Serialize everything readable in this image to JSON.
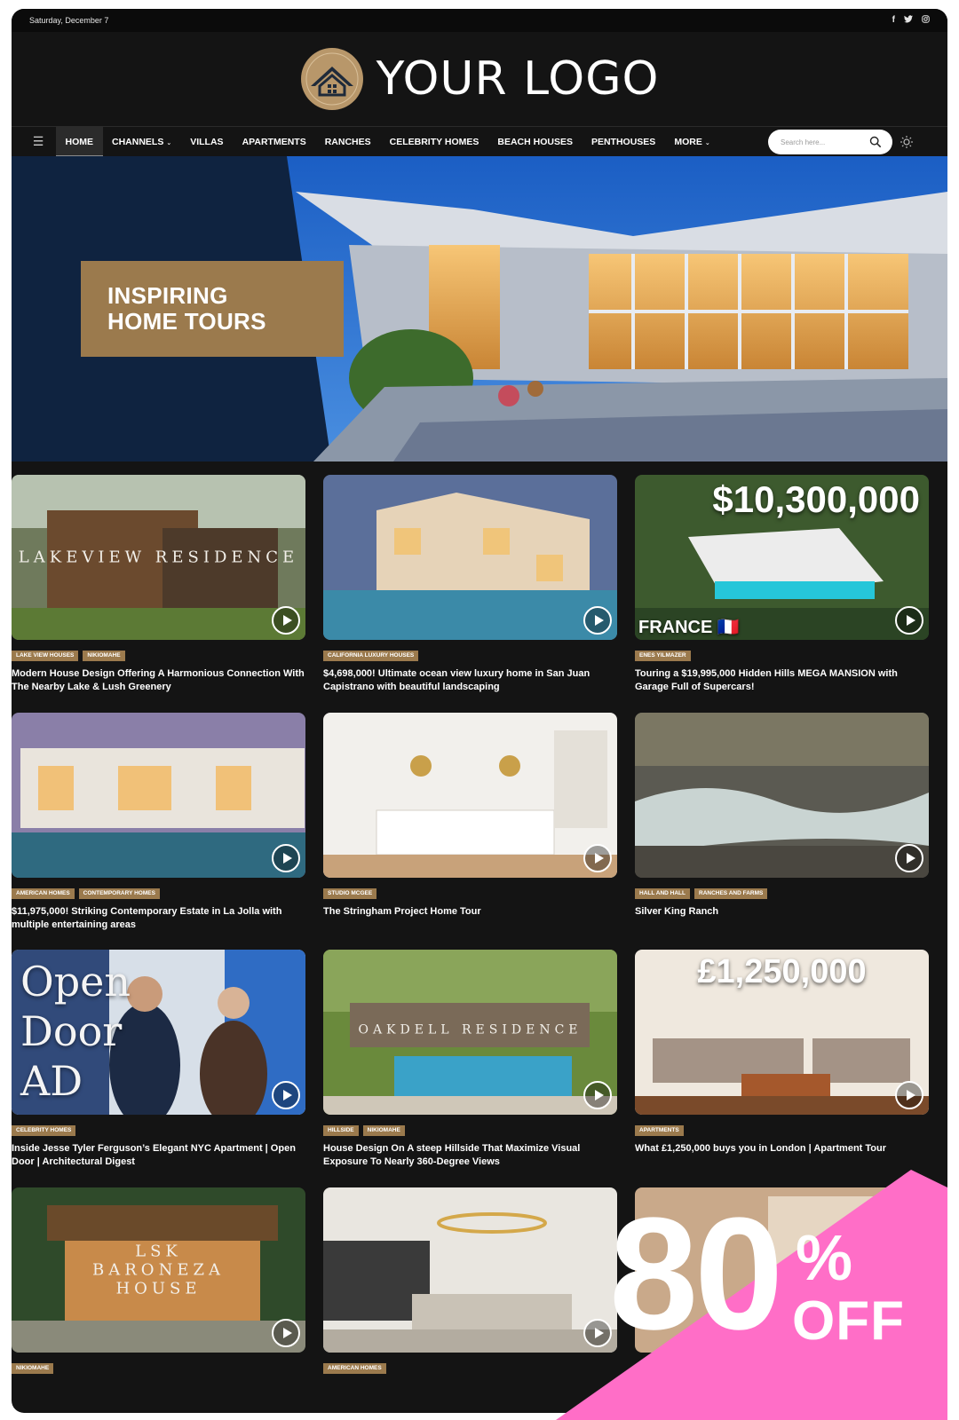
{
  "topbar": {
    "date": "Saturday, December 7",
    "socials": [
      {
        "icon": "facebook-icon",
        "glyph": "f"
      },
      {
        "icon": "twitter-icon",
        "glyph": "🐦"
      },
      {
        "icon": "instagram-icon",
        "glyph": "◎"
      }
    ]
  },
  "logo": {
    "text": "YOUR LOGO"
  },
  "nav": {
    "items": [
      {
        "label": "HOME",
        "active": true
      },
      {
        "label": "CHANNELS",
        "dropdown": true
      },
      {
        "label": "VILLAS"
      },
      {
        "label": "APARTMENTS"
      },
      {
        "label": "RANCHES"
      },
      {
        "label": "CELEBRITY HOMES"
      },
      {
        "label": "BEACH HOUSES"
      },
      {
        "label": "PENTHOUSES"
      },
      {
        "label": "MORE",
        "dropdown": true
      }
    ],
    "search_placeholder": "Search here..."
  },
  "hero": {
    "line1": "INSPIRING",
    "line2": "HOME TOURS"
  },
  "cards": [
    {
      "overlay": "LAKEVIEW RESIDENCE",
      "tags": [
        "LAKE VIEW HOUSES",
        "NIKIOMAHE"
      ],
      "title": "Modern House Design Offering A Harmonious Connection With The Nearby Lake & Lush Greenery"
    },
    {
      "tags": [
        "CALIFORNIA LUXURY HOUSES"
      ],
      "title": "$4,698,000! Ultimate ocean view luxury home in San Juan Capistrano with beautiful landscaping"
    },
    {
      "price": "$10,300,000",
      "footer": "FRANCE 🇫🇷",
      "tags": [
        "ENES YILMAZER"
      ],
      "title": "Touring a $19,995,000 Hidden Hills MEGA MANSION with Garage Full of Supercars!"
    },
    {
      "tags": [
        "AMERICAN HOMES",
        "CONTEMPORARY HOMES"
      ],
      "title": "$11,975,000! Striking Contemporary Estate in La Jolla with multiple entertaining areas"
    },
    {
      "tags": [
        "STUDIO MCGEE"
      ],
      "title": "The Stringham Project Home Tour"
    },
    {
      "tags": [
        "HALL AND HALL",
        "RANCHES AND FARMS"
      ],
      "title": "Silver King Ranch"
    },
    {
      "open": "Open Door AD",
      "tags": [
        "CELEBRITY HOMES"
      ],
      "title": "Inside Jesse Tyler Ferguson’s Elegant NYC Apartment | Open Door | Architectural Digest"
    },
    {
      "overlay": "OAKDELL RESIDENCE",
      "tags": [
        "HILLSIDE",
        "NIKIOMAHE"
      ],
      "title": "House Design On A steep Hillside That Maximize Visual Exposure To Nearly 360-Degree Views"
    },
    {
      "price": "£1,250,000",
      "tags": [
        "APARTMENTS"
      ],
      "title": "What £1,250,000 buys you in London | Apartment Tour"
    },
    {
      "overlay": "LSK BARONEZA HOUSE",
      "tags": [
        "NIKIOMAHE"
      ],
      "title": ""
    },
    {
      "tags": [
        "AMERICAN HOMES"
      ],
      "title": ""
    },
    {
      "tags": [],
      "title": ""
    }
  ],
  "promo": {
    "number": "80",
    "percent": "%",
    "off": "OFF"
  }
}
